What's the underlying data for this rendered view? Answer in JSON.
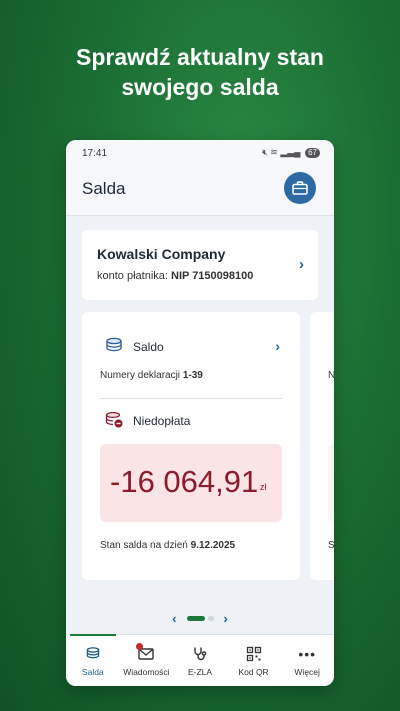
{
  "headline": {
    "line1": "Sprawdź aktualny stan",
    "line2": "swojego salda"
  },
  "statusbar": {
    "time": "17:41",
    "battery": "67"
  },
  "appbar": {
    "title": "Salda",
    "action_icon": "briefcase-icon"
  },
  "company": {
    "name": "Kowalski Company",
    "payer_prefix": "konto płatnika:",
    "payer_nip": "NIP 7150098100"
  },
  "card": {
    "saldo_label": "Saldo",
    "declarations_prefix": "Numery deklaracji",
    "declarations_range": "1-39",
    "underpayment_label": "Niedopłata",
    "amount": "-16 064,91",
    "currency": "zł",
    "asof_prefix": "Stan salda na dzień",
    "asof_date": "9.12.2025"
  },
  "card_peek": {
    "row1": "N",
    "row2": "S"
  },
  "colors": {
    "accent": "#1b7a3a",
    "brand_blue": "#2b6aa3",
    "debt_red": "#8c1b2b",
    "debt_bg": "#fbe4e6"
  },
  "nav": [
    {
      "label": "Salda",
      "icon": "coins-icon",
      "active": true
    },
    {
      "label": "Wiadomości",
      "icon": "envelope-icon",
      "badge": true
    },
    {
      "label": "E-ZLA",
      "icon": "stethoscope-icon"
    },
    {
      "label": "Kod QR",
      "icon": "qr-code-icon"
    },
    {
      "label": "Więcej",
      "icon": "more-icon"
    }
  ]
}
